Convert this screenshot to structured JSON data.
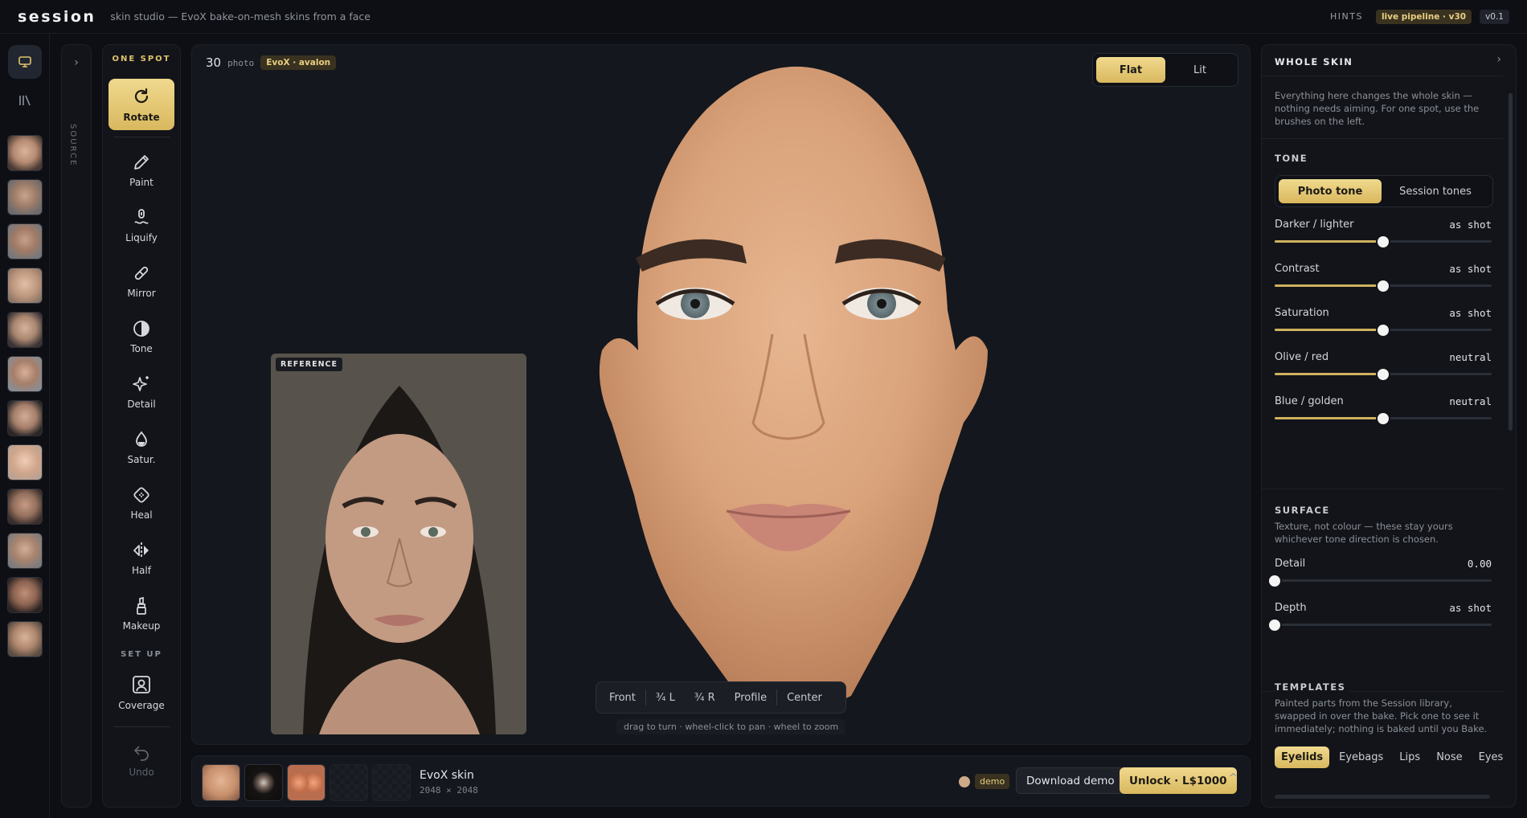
{
  "topbar": {
    "logo": "session",
    "subtitle": "skin studio — EvoX bake-on-mesh skins from a face",
    "hints": "HINTS",
    "pipeline": "live pipeline · v30",
    "version": "v0.1"
  },
  "source": {
    "label": "SOURCE",
    "toggle": "›"
  },
  "tools": {
    "one_spot": "ONE SPOT",
    "set_up": "SET UP",
    "items": [
      {
        "label": "Rotate",
        "icon": "rotate-icon",
        "active": true
      },
      {
        "label": "Paint",
        "icon": "pencil-icon"
      },
      {
        "label": "Liquify",
        "icon": "liquify-icon"
      },
      {
        "label": "Mirror",
        "icon": "mirror-icon"
      },
      {
        "label": "Tone",
        "icon": "tone-icon"
      },
      {
        "label": "Detail",
        "icon": "sparkle-icon"
      },
      {
        "label": "Satur.",
        "icon": "droplet-icon"
      },
      {
        "label": "Heal",
        "icon": "bandage-icon"
      },
      {
        "label": "Half",
        "icon": "half-icon"
      },
      {
        "label": "Makeup",
        "icon": "lipstick-icon"
      }
    ],
    "coverage": "Coverage",
    "undo": "Undo"
  },
  "viewport": {
    "count": "30",
    "photo": "photo",
    "badge": "EvoX · avalon",
    "modes": [
      "Flat",
      "Lit"
    ],
    "active_mode": "Flat",
    "reference": "REFERENCE",
    "views": [
      "Front",
      "¾ L",
      "¾ R",
      "Profile",
      "Center"
    ],
    "hint": "drag to turn · wheel-click to pan · wheel to zoom"
  },
  "bottom": {
    "name": "EvoX skin",
    "resolution": "2048 × 2048",
    "demo": "demo",
    "download": "Download demo",
    "unlock": "Unlock · L$1000",
    "caret": "^"
  },
  "panel": {
    "title": "WHOLE SKIN",
    "chevron": "›",
    "intro": "Everything here changes the whole skin — nothing needs aiming. For one spot, use the brushes on the left.",
    "tone": {
      "heading": "TONE",
      "tabs": [
        "Photo tone",
        "Session tones"
      ],
      "active_tab": "Photo tone",
      "sliders": [
        {
          "name": "Darker / lighter",
          "value": "as shot",
          "level": 0.5
        },
        {
          "name": "Contrast",
          "value": "as shot",
          "level": 0.5
        },
        {
          "name": "Saturation",
          "value": "as shot",
          "level": 0.5
        },
        {
          "name": "Olive / red",
          "value": "neutral",
          "level": 0.5
        },
        {
          "name": "Blue / golden",
          "value": "neutral",
          "level": 0.5
        }
      ]
    },
    "surface": {
      "heading": "SURFACE",
      "desc": "Texture, not colour — these stay yours whichever tone direction is chosen.",
      "sliders": [
        {
          "name": "Detail",
          "value": "0.00",
          "level": 0
        },
        {
          "name": "Depth",
          "value": "as shot",
          "level": 0
        }
      ]
    },
    "templates": {
      "heading": "TEMPLATES",
      "desc": "Painted parts from the Session library, swapped in over the bake. Pick one to see it immediately; nothing is baked until you Bake.",
      "tabs": [
        "Eyelids",
        "Eyebags",
        "Lips",
        "Nose",
        "Eyes"
      ],
      "active_tab": "Eyelids"
    }
  },
  "colors": {
    "accent": "#e0c36e",
    "background": "#0d0f14"
  }
}
